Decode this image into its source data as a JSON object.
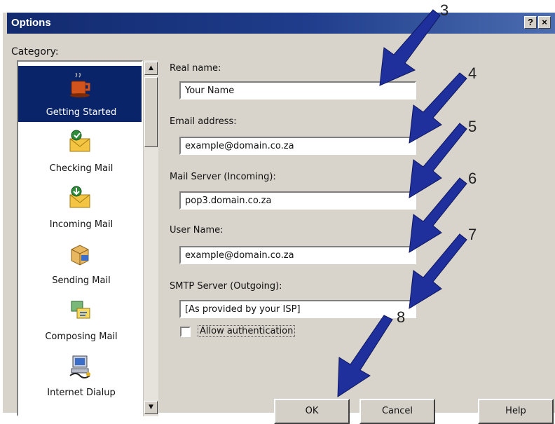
{
  "window": {
    "title": "Options",
    "help_glyph": "?",
    "close_glyph": "×"
  },
  "category": {
    "label": "Category:",
    "items": [
      {
        "label": "Getting Started",
        "icon": "coffee-cup-icon",
        "selected": true
      },
      {
        "label": "Checking Mail",
        "icon": "envelope-check-icon"
      },
      {
        "label": "Incoming Mail",
        "icon": "envelope-incoming-icon"
      },
      {
        "label": "Sending Mail",
        "icon": "package-send-icon"
      },
      {
        "label": "Composing Mail",
        "icon": "compose-icon"
      },
      {
        "label": "Internet Dialup",
        "icon": "computer-dialup-icon"
      }
    ],
    "scroll_up": "▲",
    "scroll_down": "▼"
  },
  "form": {
    "real_name_label": "Real name:",
    "real_name_value": "Your Name",
    "email_label": "Email address:",
    "email_value": "example@domain.co.za",
    "incoming_label": "Mail Server (Incoming):",
    "incoming_value": "pop3.domain.co.za",
    "username_label": "User Name:",
    "username_value": "example@domain.co.za",
    "smtp_label": "SMTP Server (Outgoing):",
    "smtp_value": "[As provided by your ISP]",
    "auth_label": "Allow authentication",
    "auth_checked": false
  },
  "buttons": {
    "ok": "OK",
    "cancel": "Cancel",
    "help": "Help"
  },
  "annotations": {
    "color": "#1f2f9c",
    "labels": [
      "3",
      "4",
      "5",
      "6",
      "7",
      "8"
    ]
  }
}
